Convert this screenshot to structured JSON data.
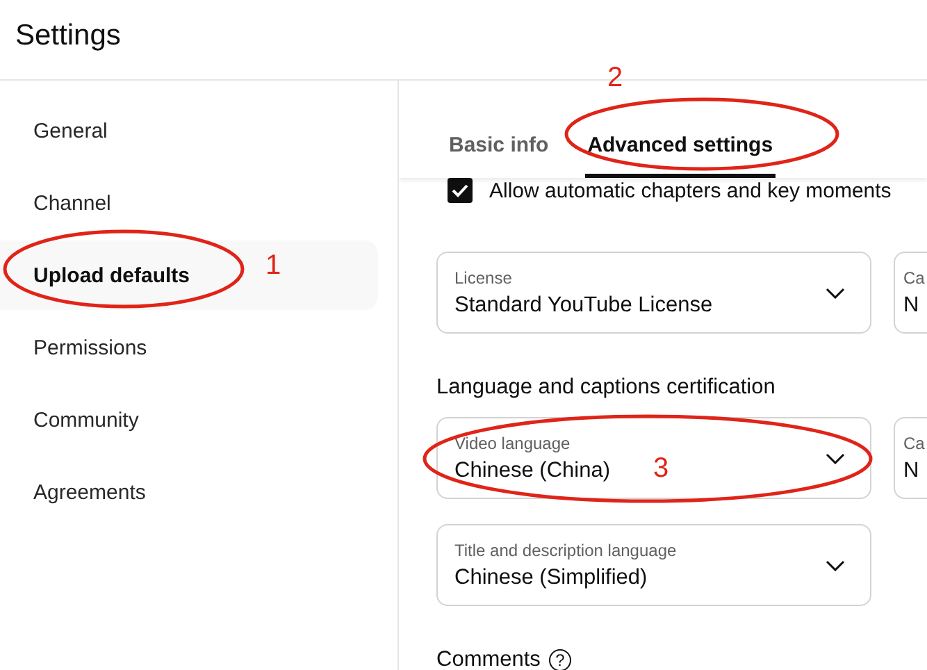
{
  "header": {
    "title": "Settings"
  },
  "sidebar": {
    "items": [
      {
        "label": "General",
        "selected": false
      },
      {
        "label": "Channel",
        "selected": false
      },
      {
        "label": "Upload defaults",
        "selected": true
      },
      {
        "label": "Permissions",
        "selected": false
      },
      {
        "label": "Community",
        "selected": false
      },
      {
        "label": "Agreements",
        "selected": false
      }
    ]
  },
  "tabs": [
    {
      "label": "Basic info",
      "selected": false
    },
    {
      "label": "Advanced settings",
      "selected": true
    }
  ],
  "checkbox": {
    "label": "Allow automatic chapters and key moments",
    "checked": true
  },
  "license_row": [
    {
      "kind": "full",
      "label": "License",
      "value": "Standard YouTube License"
    },
    {
      "kind": "partial",
      "label": "Ca",
      "value": "N"
    }
  ],
  "section_heading": "Language and captions certification",
  "language_row": [
    {
      "kind": "full",
      "label": "Video language",
      "value": "Chinese (China)"
    },
    {
      "kind": "partial",
      "label": "Ca",
      "value": "N"
    }
  ],
  "title_language": {
    "kind": "full",
    "label": "Title and description language",
    "value": "Chinese (Simplified)"
  },
  "comments": {
    "heading": "Comments",
    "help_icon": "?"
  },
  "annotations": [
    {
      "label": "1"
    },
    {
      "label": "2"
    },
    {
      "label": "3"
    }
  ]
}
